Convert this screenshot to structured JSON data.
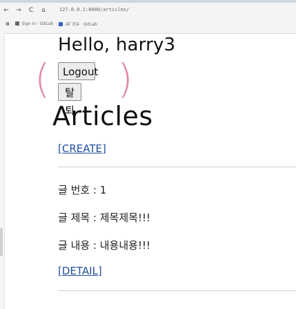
{
  "browser": {
    "nav": {
      "back": "←",
      "forward": "→",
      "reload": "C",
      "home": "⌂"
    },
    "url": "127.0.0.1:8000/articles/",
    "bookmarks": [
      "Sign in · GitLab",
      "AT 공유 · GitLab"
    ]
  },
  "page": {
    "greeting": "Hello, harry3",
    "logout_label": "Logout",
    "withdraw_label": "탈퇴",
    "articles_heading": "Articles",
    "create_link": "[CREATE]",
    "article": {
      "number_label": "글 번호 : 1",
      "title_label": "글 제목 : 제목제목!!!",
      "content_label": "글 내용 : 내용내용!!!",
      "detail_link": "[DETAIL]"
    }
  },
  "colors": {
    "accent_link": "#1f4e99",
    "annotation_paren": "#e08aa8"
  }
}
